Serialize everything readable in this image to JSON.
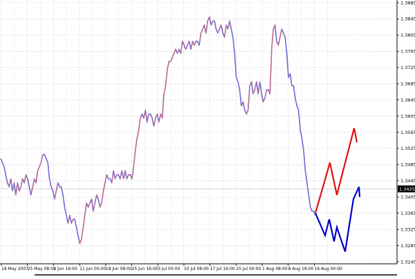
{
  "chart_data": {
    "type": "line",
    "title": "",
    "xlabel": "",
    "ylabel": "",
    "ylim": [
      1.3245,
      1.3885
    ],
    "y_ticks": [
      "1.3885",
      "1.3845",
      "1.3805",
      "1.3765",
      "1.3725",
      "1.3685",
      "1.3645",
      "1.3605",
      "1.3565",
      "1.3525",
      "1.3485",
      "1.3445",
      "1.3405",
      "1.3365",
      "1.3325",
      "1.3285",
      "1.3245"
    ],
    "current_price": "1.3425",
    "x_tick_labels": [
      "18 May 2007",
      "25 May 08:00",
      "1 Jun 16:00",
      "11 Jun 00:00",
      "18 Jun 08:00",
      "25 Jun 16:00",
      "3 Jul 00:00",
      "10 Jul 08:00",
      "17 Jul 16:00",
      "25 Jul 00:00",
      "1 Aug 08:00",
      "8 Aug 16:00",
      "16 Aug 00:00"
    ],
    "grid": true,
    "series": [
      {
        "color": "#6b6bd6",
        "values": [
          1.35,
          1.349,
          1.348,
          1.346,
          1.344,
          1.343,
          1.345,
          1.342,
          1.344,
          1.341,
          1.344,
          1.342,
          1.343,
          1.345,
          1.344,
          1.346,
          1.345,
          1.343,
          1.341,
          1.343,
          1.345,
          1.344,
          1.347,
          1.348,
          1.349,
          1.351,
          1.351,
          1.35,
          1.349,
          1.345,
          1.343,
          1.342,
          1.34,
          1.342,
          1.344,
          1.343,
          1.343,
          1.341,
          1.338,
          1.336,
          1.334,
          1.336,
          1.334,
          1.335,
          1.335,
          1.333,
          1.331,
          1.329,
          1.33,
          1.333,
          1.336,
          1.339,
          1.338,
          1.339,
          1.34,
          1.337,
          1.339,
          1.341,
          1.34,
          1.338,
          1.339,
          1.342,
          1.344,
          1.346,
          1.345,
          1.345,
          1.344,
          1.347,
          1.345,
          1.346,
          1.346,
          1.345,
          1.347,
          1.345,
          1.347,
          1.345,
          1.346,
          1.346,
          1.345,
          1.348,
          1.352,
          1.355,
          1.357,
          1.36,
          1.361,
          1.36,
          1.362,
          1.359,
          1.361,
          1.361,
          1.36,
          1.358,
          1.36,
          1.361,
          1.359,
          1.361,
          1.36,
          1.366,
          1.368,
          1.372,
          1.374,
          1.374,
          1.375,
          1.376,
          1.377,
          1.376,
          1.377,
          1.376,
          1.379,
          1.378,
          1.377,
          1.378,
          1.379,
          1.377,
          1.379,
          1.378,
          1.379,
          1.379,
          1.378,
          1.381,
          1.382,
          1.383,
          1.381,
          1.384,
          1.385,
          1.383,
          1.384,
          1.384,
          1.382,
          1.381,
          1.382,
          1.383,
          1.381,
          1.38,
          1.383,
          1.382,
          1.384,
          1.382,
          1.38,
          1.376,
          1.37,
          1.369,
          1.367,
          1.363,
          1.364,
          1.362,
          1.361,
          1.362,
          1.368,
          1.369,
          1.366,
          1.367,
          1.369,
          1.366,
          1.369,
          1.366,
          1.364,
          1.365,
          1.367,
          1.367,
          1.366,
          1.377,
          1.382,
          1.383,
          1.379,
          1.378,
          1.38,
          1.382,
          1.381,
          1.38,
          1.376,
          1.37,
          1.371,
          1.368,
          1.368,
          1.365,
          1.363,
          1.362,
          1.357,
          1.355,
          1.352,
          1.347,
          1.344,
          1.341,
          1.338,
          1.337,
          1.337,
          1.336
        ]
      },
      {
        "name": "",
        "color": "#dd1111",
        "values": [
          1.3365,
          1.349,
          1.341,
          1.3575,
          1.354
        ]
      },
      {
        "name": "",
        "color": "#0000cc",
        "values": [
          1.3365,
          1.331,
          1.335,
          1.3295,
          1.333,
          1.327,
          1.34,
          1.343,
          1.3405
        ]
      }
    ]
  },
  "price_scale": {
    "current_label": "1.3425"
  }
}
